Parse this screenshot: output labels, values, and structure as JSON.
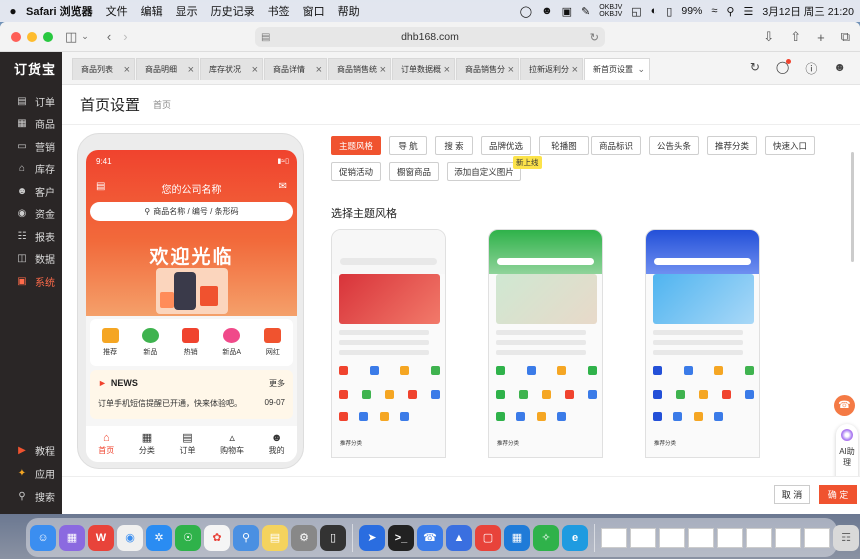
{
  "menubar": {
    "apple": "",
    "items": [
      "Safari 浏览器",
      "文件",
      "编辑",
      "显示",
      "历史记录",
      "书签",
      "窗口",
      "帮助"
    ],
    "keyboard": [
      "OKBJV",
      "OKBJV"
    ],
    "battery": "99%",
    "datetime": "3月12日 周三 21:20"
  },
  "browser": {
    "url": "dhb168.com"
  },
  "sidebar": {
    "logo": "订货宝",
    "items": [
      {
        "label": "订单",
        "icon": "order-icon"
      },
      {
        "label": "商品",
        "icon": "goods-icon"
      },
      {
        "label": "营销",
        "icon": "marketing-icon"
      },
      {
        "label": "库存",
        "icon": "inventory-icon"
      },
      {
        "label": "客户",
        "icon": "customer-icon"
      },
      {
        "label": "资金",
        "icon": "funds-icon"
      },
      {
        "label": "报表",
        "icon": "report-icon"
      },
      {
        "label": "数据",
        "icon": "data-icon"
      },
      {
        "label": "系统",
        "icon": "system-icon",
        "active": true
      }
    ],
    "bottom": [
      {
        "label": "教程",
        "icon": "tutorial-icon"
      },
      {
        "label": "应用",
        "icon": "apps-icon"
      },
      {
        "label": "搜索",
        "icon": "search-icon"
      }
    ]
  },
  "tabs": [
    {
      "label": "商品列表"
    },
    {
      "label": "商品明细"
    },
    {
      "label": "库存状况"
    },
    {
      "label": "商品详情"
    },
    {
      "label": "商品销售统"
    },
    {
      "label": "订单数据概"
    },
    {
      "label": "商品销售分"
    },
    {
      "label": "拉新返利分"
    },
    {
      "label": "新首页设置",
      "active": true
    }
  ],
  "page": {
    "title": "首页设置",
    "crumb": "首页"
  },
  "preview": {
    "time": "9:41",
    "company": "您的公司名称",
    "search": "商品名称 / 编号 / 条形码",
    "welcome": "欢迎光临",
    "icons": [
      {
        "label": "推荐",
        "color": "#f5a623"
      },
      {
        "label": "新品",
        "color": "#3fb34f"
      },
      {
        "label": "热销",
        "color": "#f0432e"
      },
      {
        "label": "新品A",
        "color": "#f04a8a"
      },
      {
        "label": "网红",
        "color": "#f0532f"
      }
    ],
    "news_title": "NEWS",
    "news_more": "更多",
    "news_text": "订单手机短信提醒已开通，快来体验吧。",
    "news_date": "09-07",
    "tabbar": [
      {
        "label": "首页",
        "active": true
      },
      {
        "label": "分类"
      },
      {
        "label": "订单"
      },
      {
        "label": "购物车"
      },
      {
        "label": "我的"
      }
    ]
  },
  "settings": {
    "buttons": [
      "主题风格",
      "导 航",
      "搜 索",
      "品牌优选",
      "轮播图",
      "商品标识",
      "公告头条",
      "推荐分类",
      "快速入口",
      "促销活动",
      "橱窗商品",
      "添加自定义图片"
    ],
    "active_button": "主题风格",
    "new_tag": "新上线",
    "section_title": "选择主题风格",
    "themes": [
      {
        "name": "red",
        "accent": "#f0432e",
        "caption": "推荐分类"
      },
      {
        "name": "green",
        "accent": "#2fb24a",
        "caption": "推荐分类"
      },
      {
        "name": "blue",
        "accent": "#2350d8",
        "caption": "推荐分类"
      }
    ]
  },
  "footer": {
    "cancel": "取 消",
    "ok": "确 定"
  },
  "ai": {
    "label": "AI助理"
  },
  "colors": {
    "accent": "#f0532f",
    "sidebar": "#2a2626"
  }
}
